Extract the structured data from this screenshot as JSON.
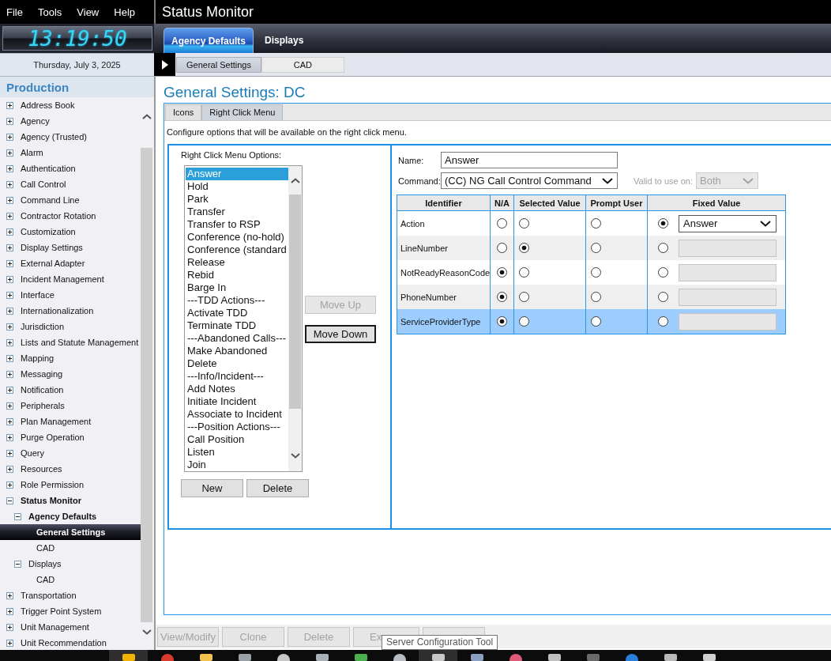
{
  "menu_bar": [
    "File",
    "Tools",
    "View",
    "Help"
  ],
  "clock": {
    "time": "13:19:50"
  },
  "date": "Thursday, July 3, 2025",
  "window": {
    "title": "Status Monitor"
  },
  "tabs": [
    {
      "label": "Agency Defaults",
      "selected": true
    },
    {
      "label": "Displays",
      "selected": false
    }
  ],
  "sub_tabs": [
    {
      "label": "General Settings",
      "selected": true
    },
    {
      "label": "CAD",
      "selected": false
    }
  ],
  "sidebar": {
    "title": "Production",
    "items": [
      {
        "label": "Address Book",
        "expanded": false,
        "selected": false
      },
      {
        "label": "Agency",
        "expanded": false,
        "selected": false
      },
      {
        "label": "Agency (Trusted)",
        "expanded": false,
        "selected": false
      },
      {
        "label": "Alarm",
        "expanded": false,
        "selected": false
      },
      {
        "label": "Authentication",
        "expanded": false,
        "selected": false
      },
      {
        "label": "Call Control",
        "expanded": false,
        "selected": false
      },
      {
        "label": "Command Line",
        "expanded": false,
        "selected": false
      },
      {
        "label": "Contractor Rotation",
        "expanded": false,
        "selected": false
      },
      {
        "label": "Customization",
        "expanded": false,
        "selected": false
      },
      {
        "label": "Display Settings",
        "expanded": false,
        "selected": false
      },
      {
        "label": "External Adapter",
        "expanded": false,
        "selected": false
      },
      {
        "label": "Incident Management",
        "expanded": false,
        "selected": false
      },
      {
        "label": "Interface",
        "expanded": false,
        "selected": false
      },
      {
        "label": "Internationalization",
        "expanded": false,
        "selected": false
      },
      {
        "label": "Jurisdiction",
        "expanded": false,
        "selected": false
      },
      {
        "label": "Lists and Statute Management",
        "expanded": false,
        "selected": false
      },
      {
        "label": "Mapping",
        "expanded": false,
        "selected": false
      },
      {
        "label": "Messaging",
        "expanded": false,
        "selected": false
      },
      {
        "label": "Notification",
        "expanded": false,
        "selected": false
      },
      {
        "label": "Peripherals",
        "expanded": false,
        "selected": false
      },
      {
        "label": "Plan Management",
        "expanded": false,
        "selected": false
      },
      {
        "label": "Purge Operation",
        "expanded": false,
        "selected": false
      },
      {
        "label": "Query",
        "expanded": false,
        "selected": false
      },
      {
        "label": "Resources",
        "expanded": false,
        "selected": false
      },
      {
        "label": "Role Permission",
        "expanded": false,
        "selected": false
      },
      {
        "label": "Status Monitor",
        "expanded": true,
        "selected": false,
        "children": [
          {
            "label": "Agency Defaults",
            "expanded": true,
            "selected": false,
            "children": [
              {
                "label": "General Settings",
                "selected": true
              },
              {
                "label": "CAD",
                "selected": false
              }
            ]
          },
          {
            "label": "Displays",
            "expanded": true,
            "selected": false,
            "children": [
              {
                "label": "CAD",
                "selected": false
              }
            ]
          }
        ]
      },
      {
        "label": "Transportation",
        "expanded": false,
        "selected": false
      },
      {
        "label": "Trigger Point System",
        "expanded": false,
        "selected": false
      },
      {
        "label": "Unit Management",
        "expanded": false,
        "selected": false
      },
      {
        "label": "Unit Recommendation",
        "expanded": false,
        "selected": false
      }
    ]
  },
  "page": {
    "title": "General Settings: DC",
    "tabs": [
      {
        "label": "Icons",
        "selected": false
      },
      {
        "label": "Right Click Menu",
        "selected": true
      }
    ],
    "description": "Configure options that will be available on the right click menu.",
    "options": {
      "label": "Right Click Menu Options:",
      "items": [
        {
          "label": "Answer",
          "selected": true
        },
        {
          "label": "Hold",
          "selected": false
        },
        {
          "label": "Park",
          "selected": false
        },
        {
          "label": "Transfer",
          "selected": false
        },
        {
          "label": "Transfer to RSP",
          "selected": false
        },
        {
          "label": "Conference (no-hold)",
          "selected": false
        },
        {
          "label": "Conference (standard",
          "selected": false
        },
        {
          "label": "Release",
          "selected": false
        },
        {
          "label": "Rebid",
          "selected": false
        },
        {
          "label": "Barge In",
          "selected": false
        },
        {
          "label": "---TDD Actions---",
          "selected": false
        },
        {
          "label": "Activate TDD",
          "selected": false
        },
        {
          "label": "Terminate TDD",
          "selected": false
        },
        {
          "label": "---Abandoned Calls---",
          "selected": false
        },
        {
          "label": "Make Abandoned",
          "selected": false
        },
        {
          "label": "Delete",
          "selected": false
        },
        {
          "label": "---Info/Incident---",
          "selected": false
        },
        {
          "label": "Add Notes",
          "selected": false
        },
        {
          "label": "Initiate Incident",
          "selected": false
        },
        {
          "label": "Associate to Incident",
          "selected": false
        },
        {
          "label": "---Position Actions---",
          "selected": false
        },
        {
          "label": "Call Position",
          "selected": false
        },
        {
          "label": "Listen",
          "selected": false
        },
        {
          "label": "Join",
          "selected": false
        }
      ],
      "move_buttons": [
        {
          "label": "Move Up",
          "disabled": true,
          "focused": false
        },
        {
          "label": "Move Down",
          "disabled": false,
          "focused": true
        }
      ],
      "buttons": [
        "New",
        "Delete"
      ]
    },
    "editor": {
      "name": {
        "label": "Name:",
        "value": "Answer"
      },
      "command": {
        "label": "Command:",
        "value": "(CC) NG Call Control Command"
      },
      "valid_to_use_on": {
        "label": "Valid to use on:",
        "value": "Both",
        "disabled": true
      }
    },
    "table": {
      "columns": [
        "Identifier",
        "N/A",
        "Selected Value",
        "Prompt User",
        "Fixed Value"
      ],
      "rows": [
        {
          "identifier": "Action",
          "selected": false,
          "radios": {
            "na": false,
            "selected_value": false,
            "prompt_user": false,
            "fixed_value": true
          },
          "fixed_field": {
            "kind": "dropdown",
            "value": "Answer",
            "disabled": false
          }
        },
        {
          "identifier": "LineNumber",
          "selected": false,
          "radios": {
            "na": false,
            "selected_value": true,
            "prompt_user": false,
            "fixed_value": false
          },
          "fixed_field": {
            "kind": "text",
            "disabled": true
          }
        },
        {
          "identifier": "NotReadyReasonCode",
          "selected": false,
          "radios": {
            "na": true,
            "selected_value": false,
            "prompt_user": false,
            "fixed_value": false
          },
          "fixed_field": {
            "kind": "text",
            "disabled": true
          }
        },
        {
          "identifier": "PhoneNumber",
          "selected": false,
          "radios": {
            "na": true,
            "selected_value": false,
            "prompt_user": false,
            "fixed_value": false
          },
          "fixed_field": {
            "kind": "text",
            "disabled": true
          }
        },
        {
          "identifier": "ServiceProviderType",
          "selected": true,
          "radios": {
            "na": true,
            "selected_value": false,
            "prompt_user": false,
            "fixed_value": false
          },
          "fixed_field": {
            "kind": "text",
            "disabled": true
          }
        }
      ]
    },
    "buttons": [
      {
        "label": "View/Modify",
        "disabled": true
      },
      {
        "label": "Clone",
        "disabled": true
      },
      {
        "label": "Delete",
        "disabled": true
      },
      {
        "label": "Ex",
        "disabled": true
      },
      {
        "disabled": true
      }
    ],
    "tooltip": "Server Configuration Tool"
  },
  "taskbar": {
    "apps": [
      {
        "active": true
      },
      {
        "active": false
      },
      {
        "active": false
      },
      {
        "active": false
      },
      {
        "active": false
      },
      {
        "active": false
      },
      {
        "active": false
      },
      {
        "active": false
      },
      {
        "active": true
      },
      {
        "active": false
      },
      {
        "active": false
      },
      {
        "active": false
      },
      {
        "active": false
      },
      {
        "active": false
      },
      {
        "active": false
      },
      {
        "active": false
      }
    ]
  }
}
